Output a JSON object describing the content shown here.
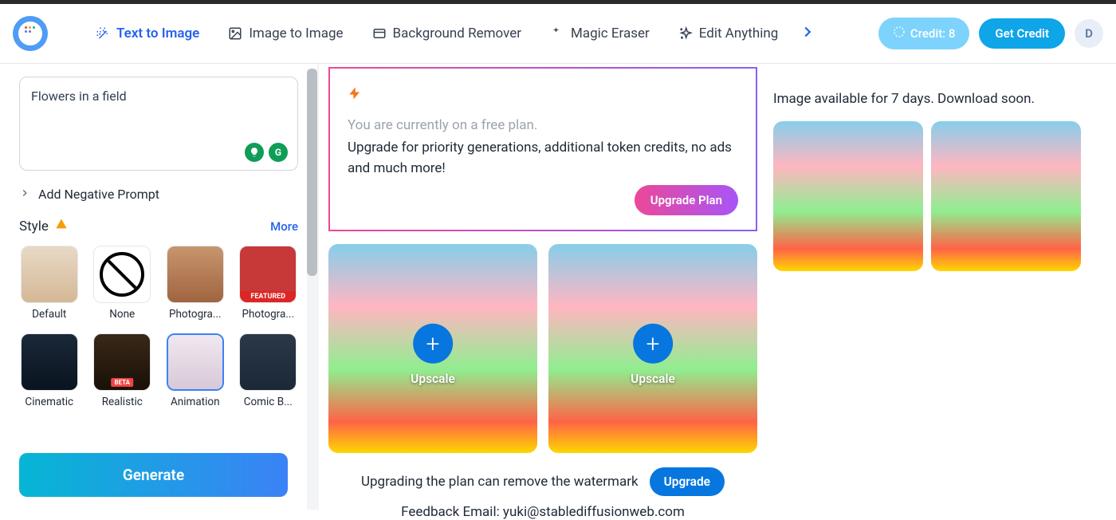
{
  "nav": {
    "items": [
      {
        "label": "Text to Image",
        "active": true
      },
      {
        "label": "Image to Image",
        "active": false
      },
      {
        "label": "Background Remover",
        "active": false
      },
      {
        "label": "Magic Eraser",
        "active": false
      },
      {
        "label": "Edit Anything",
        "active": false
      }
    ]
  },
  "header": {
    "credit_label": "Credit: 8",
    "get_credit_label": "Get Credit",
    "avatar_initial": "D"
  },
  "sidebar": {
    "prompt_value": "Flowers in a field",
    "negative_label": "Add Negative Prompt",
    "style_label": "Style",
    "more_label": "More",
    "styles": [
      {
        "name": "Default"
      },
      {
        "name": "None"
      },
      {
        "name": "Photogra..."
      },
      {
        "name": "Photogra...",
        "featured_badge": "FEATURED"
      },
      {
        "name": "Cinematic"
      },
      {
        "name": "Realistic",
        "beta_badge": "BETA"
      },
      {
        "name": "Animation",
        "selected": true
      },
      {
        "name": "Comic B..."
      }
    ],
    "generate_label": "Generate"
  },
  "center": {
    "plan_line1": "You are currently on a free plan.",
    "plan_line2": "Upgrade for priority generations, additional token credits, no ads and much more!",
    "upgrade_plan_label": "Upgrade Plan",
    "upscale_label": "Upscale",
    "watermark_text": "Upgrading the plan can remove the watermark",
    "upgrade_label": "Upgrade",
    "feedback_prefix": "Feedback Email: ",
    "feedback_email": "yuki@stablediffusionweb.com"
  },
  "right": {
    "avail_text": "Image available for 7 days. Download soon."
  }
}
